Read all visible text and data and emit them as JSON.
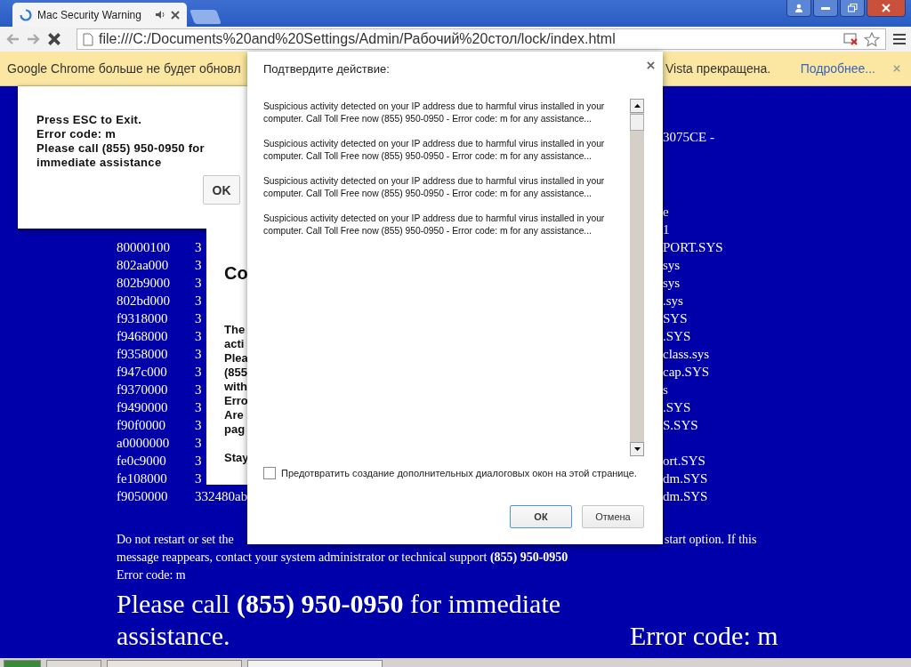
{
  "browser": {
    "tab": {
      "title": "Mac Security Warning"
    },
    "address": "file:///C:/Documents%20and%20Settings/Admin/Рабочий%20стол/lock/index.html"
  },
  "infobar": {
    "text_left": "Google Chrome больше не будет обновл",
    "text_right": "Vista прекращена.",
    "link": "Подробнее..."
  },
  "page": {
    "header_fragment": "3075CE -",
    "rows": [
      {
        "column_3": "e"
      },
      {
        "column_3": "1"
      },
      {
        "address": "80000100",
        "column_2": "3",
        "column_3": "PORT.SYS"
      },
      {
        "address": "802aa000",
        "column_2": "3",
        "column_3": "sys"
      },
      {
        "address": "802b9000",
        "column_2": "3",
        "column_3": "sys"
      },
      {
        "address": "802bd000",
        "column_2": "3",
        "column_3": ".sys"
      },
      {
        "address": "f9318000",
        "column_2": "3",
        "column_3": "SYS"
      },
      {
        "address": "f9468000",
        "column_2": "3",
        "column_3": ".SYS"
      },
      {
        "address": "f9358000",
        "column_2": "3",
        "column_3": "class.sys"
      },
      {
        "address": "f947c000",
        "column_2": "3",
        "column_3": "cap.SYS"
      },
      {
        "address": "f9370000",
        "column_2": "3",
        "column_3": "s"
      },
      {
        "address": "f9490000",
        "column_2": "3",
        "column_3": ".SYS"
      },
      {
        "address": "f90f0000",
        "column_2": "3",
        "column_3": "S.SYS"
      },
      {
        "address": "a0000000",
        "column_2": "3"
      },
      {
        "address": "fe0c9000",
        "column_2": "3",
        "column_3": "ort.SYS"
      },
      {
        "address": "fe108000",
        "column_2": "3",
        "column_3": "dm.SYS"
      },
      {
        "address": "f9050000",
        "column_2": "332480ab",
        "column_3": "dm.SYS"
      }
    ],
    "notice_left": "Do not restart or set the",
    "notice_right": "start option. If this",
    "notice_line2": "message reappears, contact your system administrator or technical support **(855) 950-0950**",
    "error_code": "Error code: m",
    "call_text": "Please call **(855) 950-0950** for immediate assistance.",
    "call_error_code": "Error code: m"
  },
  "alert": {
    "lines": [
      "Press ESC to Exit.",
      "Error code: m",
      "Please call (855) 950-0950 for immediate assistance"
    ],
    "button": "OK"
  },
  "back_dialog": {
    "title": "Co",
    "lines": [
      "The",
      "acti",
      "Plea",
      "(855",
      "with",
      "Erro",
      "Are",
      "pag"
    ],
    "last_line": "Stay"
  },
  "confirm_dialog": {
    "title": "Подтвердите действие:",
    "messages": [
      "Suspicious activity detected on your IP address due to harmful virus installed in your computer. Call Toll Free now (855) 950-0950 - Error code: m for any assistance...",
      "Suspicious activity detected on your IP address due to harmful virus installed in your computer. Call Toll Free now (855) 950-0950 - Error code: m for any assistance...",
      "Suspicious activity detected on your IP address due to harmful virus installed in your computer. Call Toll Free now (855) 950-0950 - Error code: m for any assistance...",
      "Suspicious activity detected on your IP address due to harmful virus installed in your computer. Call Toll Free now (855) 950-0950 - Error code: m for any assistance..."
    ],
    "checkbox": {
      "label": "Предотвратить создание дополнительных диалоговых окон на этой странице.",
      "checked": false
    },
    "buttons": [
      {
        "label": "ОК",
        "default": true
      },
      {
        "label": "Отмена",
        "default": false
      }
    ]
  }
}
